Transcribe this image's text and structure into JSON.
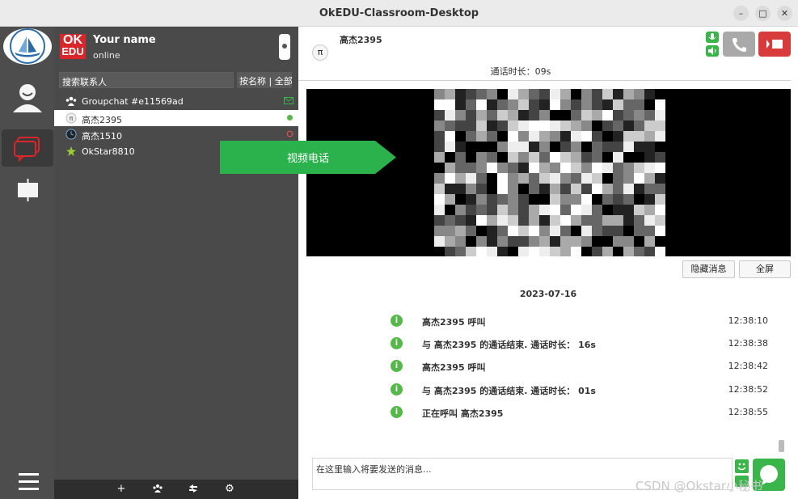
{
  "window": {
    "title": "OkEDU-Classroom-Desktop",
    "minimize_icon": "minimize-icon",
    "maximize_icon": "maximize-icon",
    "close_icon": "close-icon"
  },
  "rail": {
    "items": [
      {
        "name": "profile",
        "icon": "user-icon"
      },
      {
        "name": "chat",
        "icon": "chat-icon",
        "active": true
      },
      {
        "name": "classroom",
        "icon": "presentation-icon"
      },
      {
        "name": "menu",
        "icon": "hamburger-menu-icon"
      }
    ]
  },
  "user": {
    "logo_line1": "OK",
    "logo_line2": "EDU",
    "name": "Your name",
    "status": "online"
  },
  "search": {
    "placeholder": "搜索联系人",
    "mode": "按名称 | 全部"
  },
  "contacts": [
    {
      "name": "Groupchat #e11569ad",
      "icon": "group-icon",
      "status_icon": "envelope-icon",
      "selected": false
    },
    {
      "name": "高杰2395",
      "icon": "pi-avatar-icon",
      "status_icon": "online-dot-icon",
      "selected": true
    },
    {
      "name": "高杰1510",
      "icon": "clock-avatar-icon",
      "status_icon": "offline-ring-icon",
      "selected": false
    },
    {
      "name": "OkStar8810",
      "icon": "star-avatar-icon",
      "status_icon": "",
      "selected": false
    }
  ],
  "bottom_bar": [
    "add-icon",
    "group-add-icon",
    "transfer-icon",
    "settings-icon"
  ],
  "overlay": {
    "label": "视频电话",
    "color": "#2bb24c"
  },
  "chat": {
    "peer_name": "高杰2395",
    "peer_avatar": "π",
    "duration_label": "通话时长：",
    "duration_value": "09s",
    "hide_messages": "隐藏消息",
    "fullscreen": "全屏",
    "date": "2023-07-16",
    "messages": [
      {
        "text": "高杰2395 呼叫",
        "time": "12:38:10"
      },
      {
        "text": "与 高杰2395 的通话结束. 通话时长： 16s",
        "time": "12:38:38"
      },
      {
        "text": "高杰2395 呼叫",
        "time": "12:38:42"
      },
      {
        "text": "与 高杰2395 的通话结束. 通话时长： 01s",
        "time": "12:38:52"
      },
      {
        "text": "正在呼叫 高杰2395",
        "time": "12:38:55"
      }
    ],
    "input_placeholder": "在这里输入将要发送的消息..."
  },
  "watermark": "CSDN @Okstar小秘书",
  "colors": {
    "accent_green": "#39b54a",
    "hangup_red": "#d83b3b",
    "brand_red": "#d9262b"
  }
}
